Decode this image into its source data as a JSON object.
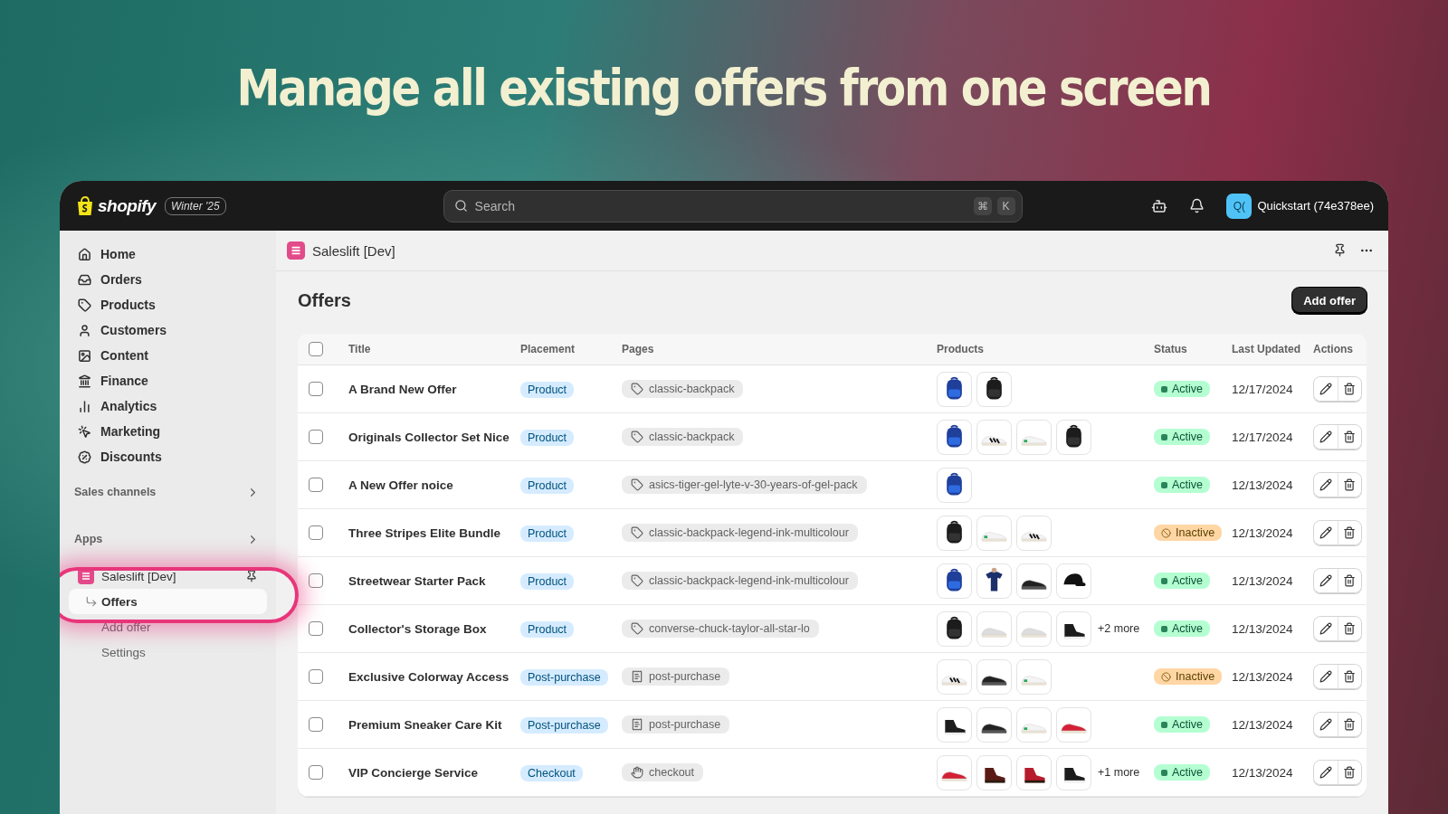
{
  "headline": "Manage all existing offers from one screen",
  "topbar": {
    "logo": "shopify",
    "edition": "Winter '25",
    "search": {
      "placeholder": "Search"
    },
    "shortcut": [
      "⌘",
      "K"
    ],
    "account": {
      "initials": "Q(",
      "name": "Quickstart (74e378ee)"
    }
  },
  "sidebar": {
    "nav": [
      "Home",
      "Orders",
      "Products",
      "Customers",
      "Content",
      "Finance",
      "Analytics",
      "Marketing",
      "Discounts"
    ],
    "sections": [
      "Sales channels",
      "Apps"
    ],
    "app": {
      "name": "Saleslift [Dev]",
      "items": [
        {
          "label": "Offers",
          "selected": true
        },
        {
          "label": "Add offer",
          "selected": false
        },
        {
          "label": "Settings",
          "selected": false
        }
      ]
    }
  },
  "app_header": {
    "title": "Saleslift [Dev]"
  },
  "page": {
    "title": "Offers",
    "primary_action": "Add offer"
  },
  "table": {
    "select_all": false,
    "columns": [
      "Title",
      "Placement",
      "Pages",
      "Products",
      "Status",
      "Last Updated",
      "Actions"
    ],
    "rows": [
      {
        "checked": false,
        "title": "A Brand New Offer",
        "placement": "Product",
        "page": {
          "kind": "product",
          "label": "classic-backpack"
        },
        "status": {
          "kind": "active",
          "label": "Active"
        },
        "updated": "12/17/2024"
      },
      {
        "checked": false,
        "title": "Originals Collector Set Nice",
        "placement": "Product",
        "page": {
          "kind": "product",
          "label": "classic-backpack"
        },
        "status": {
          "kind": "active",
          "label": "Active"
        },
        "updated": "12/17/2024"
      },
      {
        "checked": false,
        "title": "A New Offer noice",
        "placement": "Product",
        "page": {
          "kind": "product",
          "label": "asics-tiger-gel-lyte-v-30-years-of-gel-pack"
        },
        "status": {
          "kind": "active",
          "label": "Active"
        },
        "updated": "12/13/2024"
      },
      {
        "checked": false,
        "title": "Three Stripes Elite Bundle",
        "placement": "Product",
        "page": {
          "kind": "product",
          "label": "classic-backpack-legend-ink-multicolour"
        },
        "status": {
          "kind": "inactive",
          "label": "Inactive"
        },
        "updated": "12/13/2024"
      },
      {
        "checked": false,
        "title": "Streetwear Starter Pack",
        "placement": "Product",
        "page": {
          "kind": "product",
          "label": "classic-backpack-legend-ink-multicolour"
        },
        "status": {
          "kind": "active",
          "label": "Active"
        },
        "updated": "12/13/2024"
      },
      {
        "checked": false,
        "title": "Collector's Storage Box",
        "placement": "Product",
        "page": {
          "kind": "product",
          "label": "converse-chuck-taylor-all-star-lo"
        },
        "more": "+2 more",
        "status": {
          "kind": "active",
          "label": "Active"
        },
        "updated": "12/13/2024"
      },
      {
        "checked": false,
        "title": "Exclusive Colorway Access",
        "placement": "Post-purchase",
        "page": {
          "kind": "post-purchase",
          "label": "post-purchase"
        },
        "status": {
          "kind": "inactive",
          "label": "Inactive"
        },
        "updated": "12/13/2024"
      },
      {
        "checked": false,
        "title": "Premium Sneaker Care Kit",
        "placement": "Post-purchase",
        "page": {
          "kind": "post-purchase",
          "label": "post-purchase"
        },
        "status": {
          "kind": "active",
          "label": "Active"
        },
        "updated": "12/13/2024"
      },
      {
        "checked": false,
        "title": "VIP Concierge Service",
        "placement": "Checkout",
        "page": {
          "kind": "checkout",
          "label": "checkout"
        },
        "more": "+1 more",
        "status": {
          "kind": "active",
          "label": "Active"
        },
        "updated": "12/13/2024"
      }
    ]
  }
}
